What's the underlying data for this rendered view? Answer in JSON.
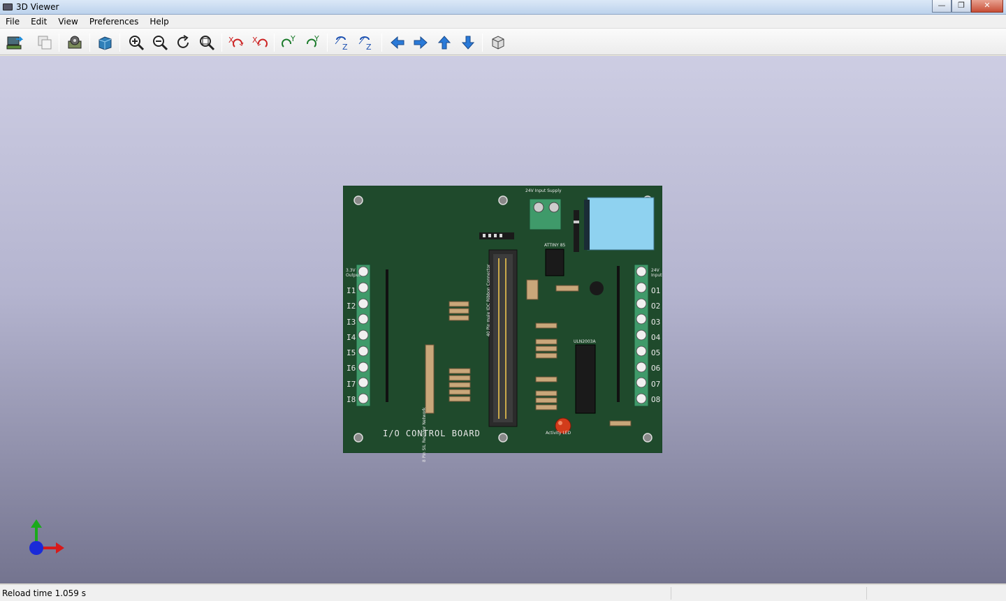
{
  "window": {
    "title": "3D Viewer",
    "minimize": "—",
    "maximize": "❐",
    "close": "✕"
  },
  "menu": {
    "file": "File",
    "edit": "Edit",
    "view": "View",
    "preferences": "Preferences",
    "help": "Help"
  },
  "toolbar": {
    "icons": [
      "reload-icon",
      "copy-image-icon",
      "settings-icon",
      "raytrace-icon",
      "zoom-in-icon",
      "zoom-out-icon",
      "redraw-icon",
      "zoom-fit-icon",
      "rotate-x-cw-icon",
      "rotate-x-ccw-icon",
      "rotate-y-cw-icon",
      "rotate-y-ccw-icon",
      "rotate-z-cw-icon",
      "rotate-z-ccw-icon",
      "pan-left-icon",
      "pan-right-icon",
      "pan-up-icon",
      "pan-down-icon",
      "ortho-view-icon"
    ]
  },
  "board": {
    "title": "I/O CONTROL BOARD",
    "supply_label": "24V Input Supply",
    "attiny_label": "ATTINY 85",
    "uln_label": "ULN2003A",
    "input_labels": [
      "I1",
      "I2",
      "I3",
      "I4",
      "I5",
      "I6",
      "I7",
      "I8"
    ],
    "output_labels": [
      "O1",
      "O2",
      "O3",
      "O4",
      "O5",
      "O6",
      "O7",
      "O8"
    ],
    "left_top_label": "3.3V Output",
    "right_top_label": "24V Input",
    "led_label": "Activity LED",
    "ribbon_label": "40 Pin male IDC Ribbon Connector",
    "resistor_net_label": "8 Pin SIL Resistor Network",
    "colors": {
      "pcb": "#1f4a2c",
      "silk": "#e8e8e8",
      "terminal": "#3f9a6a",
      "relay": "#8fd2f0",
      "led": "#d23c1b"
    }
  },
  "status": {
    "reload": "Reload time 1.059 s"
  }
}
